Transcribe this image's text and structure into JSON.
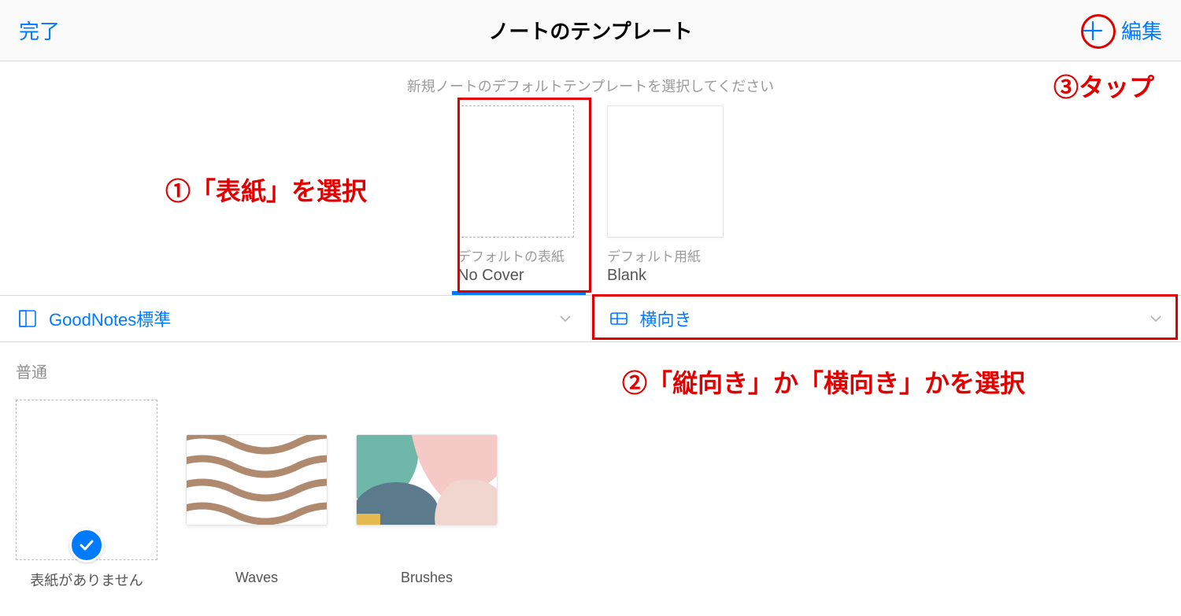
{
  "header": {
    "done": "完了",
    "title": "ノートのテンプレート",
    "edit": "編集"
  },
  "subtitle": "新規ノートのデフォルトテンプレートを選択してください",
  "defaults": {
    "cover": {
      "sublabel": "デフォルトの表紙",
      "label": "No Cover"
    },
    "paper": {
      "sublabel": "デフォルト用紙",
      "label": "Blank"
    }
  },
  "filters": {
    "library": "GoodNotes標準",
    "orientation": "横向き"
  },
  "category": {
    "title": "普通",
    "templates": [
      {
        "label": "表紙がありません",
        "selected": true,
        "style": "none"
      },
      {
        "label": "Waves",
        "style": "waves"
      },
      {
        "label": "Brushes",
        "style": "brushes"
      }
    ]
  },
  "annotations": {
    "a1": "①「表紙」を選択",
    "a2": "②「縦向き」か「横向き」かを選択",
    "a3": "③タップ"
  }
}
